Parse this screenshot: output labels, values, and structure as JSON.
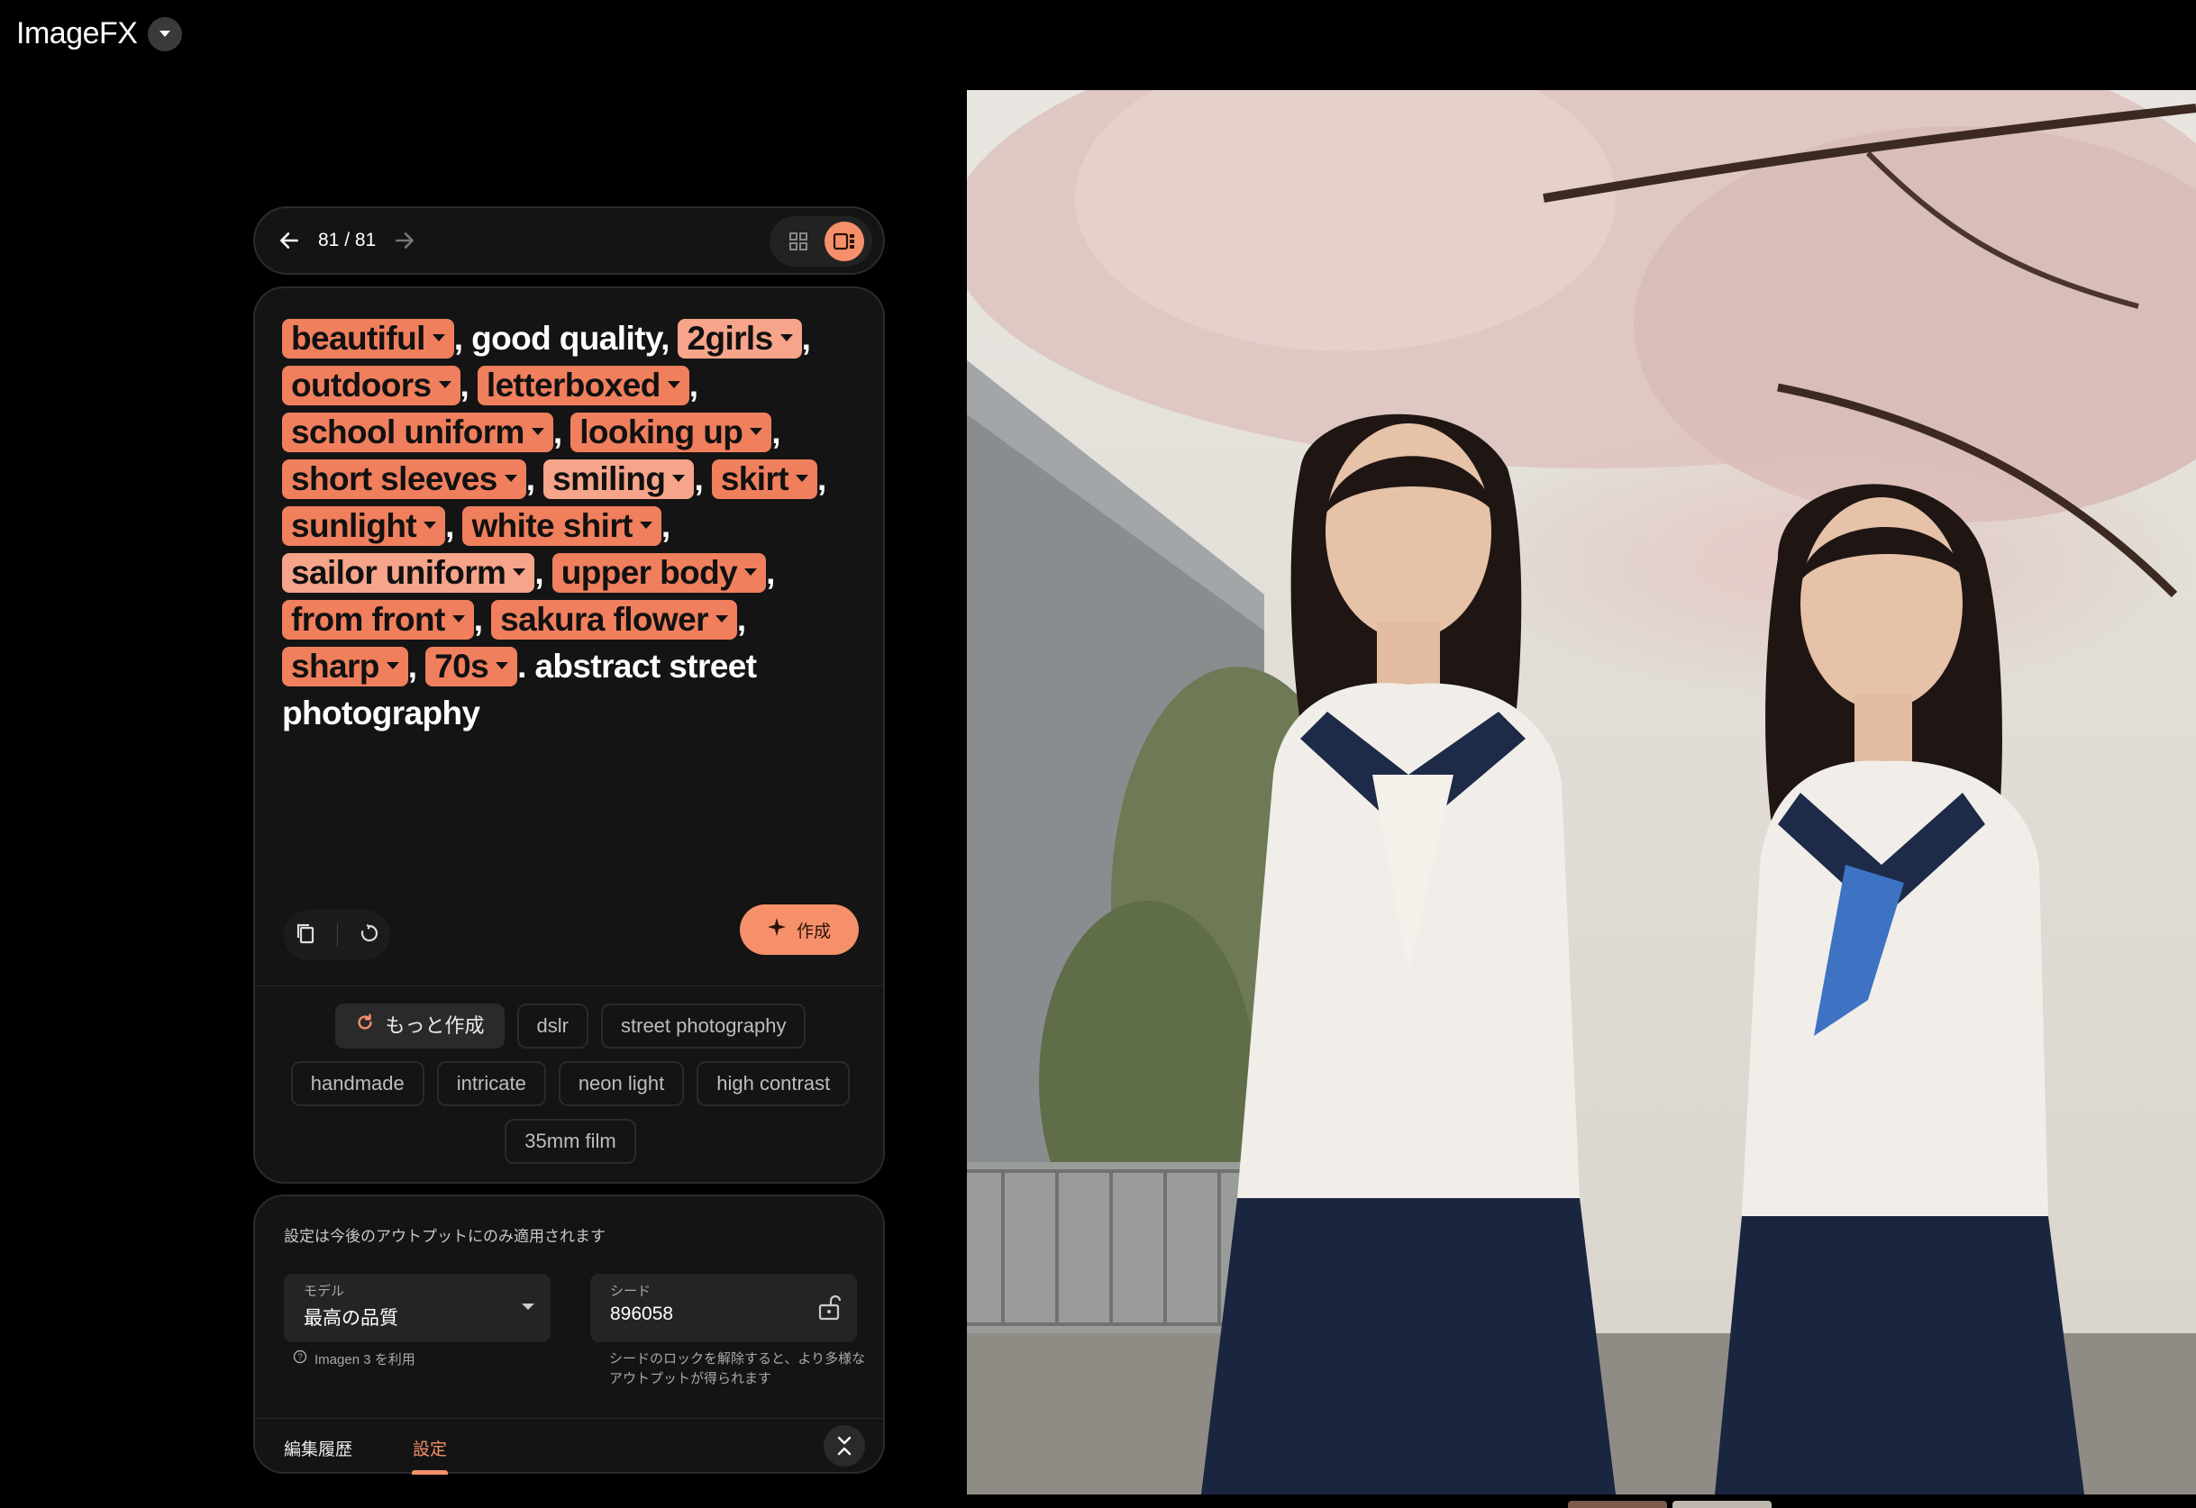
{
  "app": {
    "title": "ImageFX"
  },
  "nav": {
    "counter": "81 / 81"
  },
  "prompt": [
    {
      "type": "chip",
      "text": "beautiful",
      "light": false
    },
    {
      "type": "text",
      "text": ", good quality, "
    },
    {
      "type": "chip",
      "text": "2girls",
      "light": true
    },
    {
      "type": "text",
      "text": ", "
    },
    {
      "type": "chip",
      "text": "outdoors",
      "light": false
    },
    {
      "type": "text",
      "text": ", "
    },
    {
      "type": "chip",
      "text": "letterboxed",
      "light": false
    },
    {
      "type": "text",
      "text": ", "
    },
    {
      "type": "chip",
      "text": "school uniform",
      "light": false
    },
    {
      "type": "text",
      "text": ", "
    },
    {
      "type": "chip",
      "text": "looking up",
      "light": false
    },
    {
      "type": "text",
      "text": ", "
    },
    {
      "type": "chip",
      "text": "short sleeves",
      "light": false
    },
    {
      "type": "text",
      "text": ", "
    },
    {
      "type": "chip",
      "text": "smiling",
      "light": true
    },
    {
      "type": "text",
      "text": ", "
    },
    {
      "type": "chip",
      "text": "skirt",
      "light": false
    },
    {
      "type": "text",
      "text": ", "
    },
    {
      "type": "chip",
      "text": "sunlight",
      "light": false
    },
    {
      "type": "text",
      "text": ", "
    },
    {
      "type": "chip",
      "text": "white shirt",
      "light": false
    },
    {
      "type": "text",
      "text": ", "
    },
    {
      "type": "chip",
      "text": "sailor uniform",
      "light": true
    },
    {
      "type": "text",
      "text": ", "
    },
    {
      "type": "chip",
      "text": "upper body",
      "light": false
    },
    {
      "type": "text",
      "text": ", "
    },
    {
      "type": "chip",
      "text": "from front",
      "light": false
    },
    {
      "type": "text",
      "text": ", "
    },
    {
      "type": "chip",
      "text": "sakura flower",
      "light": false
    },
    {
      "type": "text",
      "text": ", "
    },
    {
      "type": "chip",
      "text": "sharp",
      "light": false
    },
    {
      "type": "text",
      "text": ", "
    },
    {
      "type": "chip",
      "text": "70s",
      "light": false
    },
    {
      "type": "text",
      "text": ". abstract street photography"
    }
  ],
  "actions": {
    "create_label": "作成"
  },
  "suggestions": {
    "more_label": "もっと作成",
    "items": [
      "dslr",
      "street photography",
      "handmade",
      "intricate",
      "neon light",
      "high contrast",
      "35mm film"
    ]
  },
  "settings": {
    "note": "設定は今後のアウトプットにのみ適用されます",
    "model_label": "モデル",
    "model_value": "最高の品質",
    "model_help": "Imagen 3 を利用",
    "seed_label": "シード",
    "seed_value": "896058",
    "seed_help": "シードのロックを解除すると、より多様なアウトプットが得られます"
  },
  "tabs": {
    "history": "編集履歴",
    "settings": "設定"
  },
  "colors": {
    "accent": "#f5906a",
    "chip": "#f07f5d",
    "chip_light": "#f6a48a",
    "panel": "#141414"
  },
  "icons": [
    "app-menu-caret-icon",
    "back-arrow-icon",
    "forward-arrow-icon",
    "grid-view-icon",
    "single-view-icon",
    "copy-icon",
    "refresh-icon",
    "sparkle-icon",
    "redo-icon",
    "lock-open-icon",
    "help-icon",
    "collapse-icon"
  ]
}
